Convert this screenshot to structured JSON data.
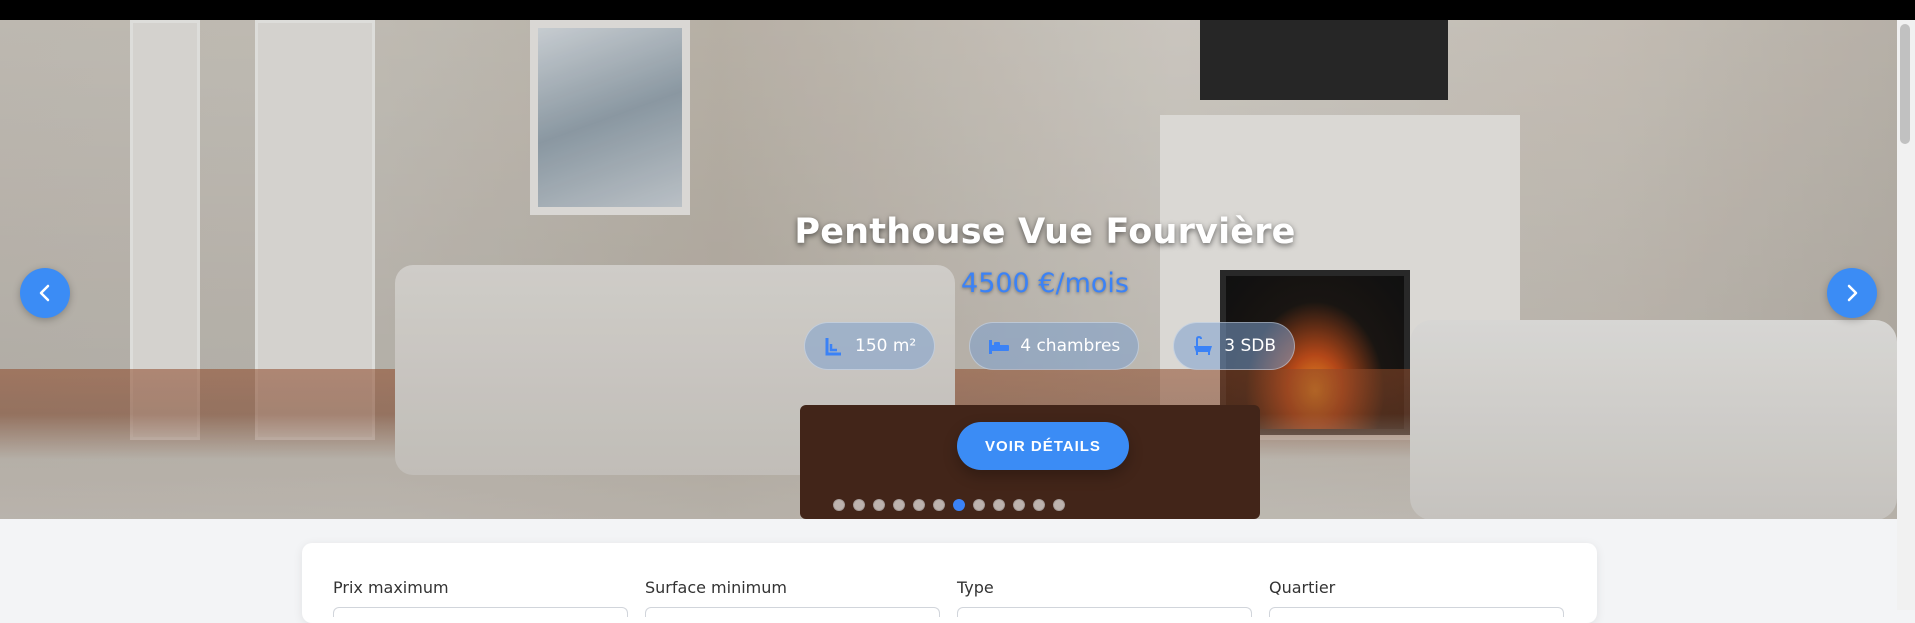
{
  "hero": {
    "title": "Penthouse Vue Fourvière",
    "price": "4500 €/mois",
    "features": [
      {
        "icon": "surface-icon",
        "label": "150 m²"
      },
      {
        "icon": "bed-icon",
        "label": "4 chambres"
      },
      {
        "icon": "bathtub-icon",
        "label": "3 SDB"
      }
    ],
    "cta_label": "VOIR DÉTAILS",
    "slides_count": 12,
    "active_slide": 7,
    "prev_icon": "chevron-left-icon",
    "next_icon": "chevron-right-icon",
    "accent_color": "#3b82f6"
  },
  "filters": {
    "max_price_label": "Prix maximum",
    "min_surface_label": "Surface minimum",
    "type_label": "Type",
    "district_label": "Quartier"
  }
}
